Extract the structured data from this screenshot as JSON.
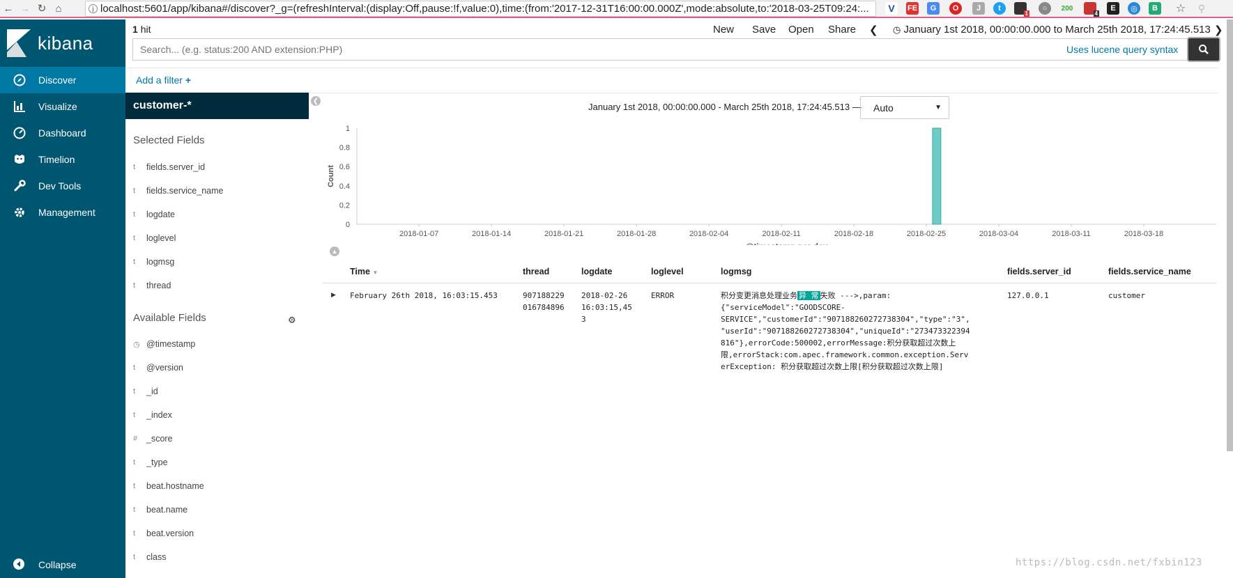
{
  "browser": {
    "url": "localhost:5601/app/kibana#/discover?_g=(refreshInterval:(display:Off,pause:!f,value:0),time:(from:'2017-12-31T16:00:00.000Z',mode:absolute,to:'2018-03-25T09:24:...",
    "ext_badge_200": "200",
    "ext_badge_1": "1",
    "ext_badge_4": "4"
  },
  "sidebar": {
    "brand": "kibana",
    "items": [
      {
        "label": "Discover",
        "icon": "compass-icon"
      },
      {
        "label": "Visualize",
        "icon": "bar-chart-icon"
      },
      {
        "label": "Dashboard",
        "icon": "dashboard-icon"
      },
      {
        "label": "Timelion",
        "icon": "timelion-icon"
      },
      {
        "label": "Dev Tools",
        "icon": "wrench-icon"
      },
      {
        "label": "Management",
        "icon": "gear-icon"
      }
    ],
    "collapse_label": "Collapse"
  },
  "topbar": {
    "hit_count": "1",
    "hit_label": "hit",
    "new_label": "New",
    "save_label": "Save",
    "open_label": "Open",
    "share_label": "Share",
    "time_range": "January 1st 2018, 00:00:00.000 to March 25th 2018, 17:24:45.513"
  },
  "search": {
    "placeholder": "Search... (e.g. status:200 AND extension:PHP)",
    "syntax_link": "Uses lucene query syntax"
  },
  "filter": {
    "add_label": "Add a filter"
  },
  "fields": {
    "index_pattern": "customer-*",
    "selected_title": "Selected Fields",
    "selected": [
      {
        "type": "t",
        "name": "fields.server_id"
      },
      {
        "type": "t",
        "name": "fields.service_name"
      },
      {
        "type": "t",
        "name": "logdate"
      },
      {
        "type": "t",
        "name": "loglevel"
      },
      {
        "type": "t",
        "name": "logmsg"
      },
      {
        "type": "t",
        "name": "thread"
      }
    ],
    "available_title": "Available Fields",
    "available": [
      {
        "type": "◷",
        "name": "@timestamp"
      },
      {
        "type": "t",
        "name": "@version"
      },
      {
        "type": "t",
        "name": "_id"
      },
      {
        "type": "t",
        "name": "_index"
      },
      {
        "type": "#",
        "name": "_score"
      },
      {
        "type": "t",
        "name": "_type"
      },
      {
        "type": "t",
        "name": "beat.hostname"
      },
      {
        "type": "t",
        "name": "beat.name"
      },
      {
        "type": "t",
        "name": "beat.version"
      },
      {
        "type": "t",
        "name": "class"
      }
    ]
  },
  "histogram": {
    "range_label": "January 1st 2018, 00:00:00.000 - March 25th 2018, 17:24:45.513 —",
    "interval": "Auto"
  },
  "chart_data": {
    "type": "bar",
    "x": [
      "2018-01-07",
      "2018-01-14",
      "2018-01-21",
      "2018-01-28",
      "2018-02-04",
      "2018-02-11",
      "2018-02-18",
      "2018-02-25",
      "2018-03-04",
      "2018-03-11",
      "2018-03-18"
    ],
    "series": [
      {
        "x": [
          "2018-02-26"
        ],
        "values": [
          1
        ]
      }
    ],
    "xlabel": "@timestamp per day",
    "ylabel": "Count",
    "yticks": [
      "0",
      "0.2",
      "0.4",
      "0.6",
      "0.8",
      "1"
    ],
    "ylim": [
      0,
      1
    ],
    "xlim": [
      "2018-01-01",
      "2018-03-25"
    ],
    "bar_color": "#6dccc4"
  },
  "table": {
    "headers": [
      "Time",
      "thread",
      "logdate",
      "loglevel",
      "logmsg",
      "fields.server_id",
      "fields.service_name"
    ],
    "row": {
      "time": "February 26th 2018, 16:03:15.453",
      "thread_l1": "907188229",
      "thread_l2": "016784896",
      "logdate_l1": "2018-02-26",
      "logdate_l2": "16:03:15,45",
      "logdate_l3": "3",
      "loglevel": "ERROR",
      "logmsg_pre": "积分变更消息处理业务",
      "logmsg_hl": "异 常",
      "logmsg_post": "失败 --->,param:",
      "logmsg_l2": "{\"serviceModel\":\"GOODSCORE-",
      "logmsg_l3": "SERVICE\",\"customerId\":\"907188260272738304\",\"type\":\"3\",",
      "logmsg_l4": "\"userId\":\"907188260272738304\",\"uniqueId\":\"273473322394",
      "logmsg_l5": "816\"},errorCode:500002,errorMessage:积分获取超过次数上",
      "logmsg_l6": "限,errorStack:com.apec.framework.common.exception.Serv",
      "logmsg_l7": "erException: 积分获取超过次数上限[积分获取超过次数上限]",
      "server_id": "127.0.0.1",
      "service_name": "customer"
    }
  },
  "watermark": "https://blog.csdn.net/fxbin123"
}
